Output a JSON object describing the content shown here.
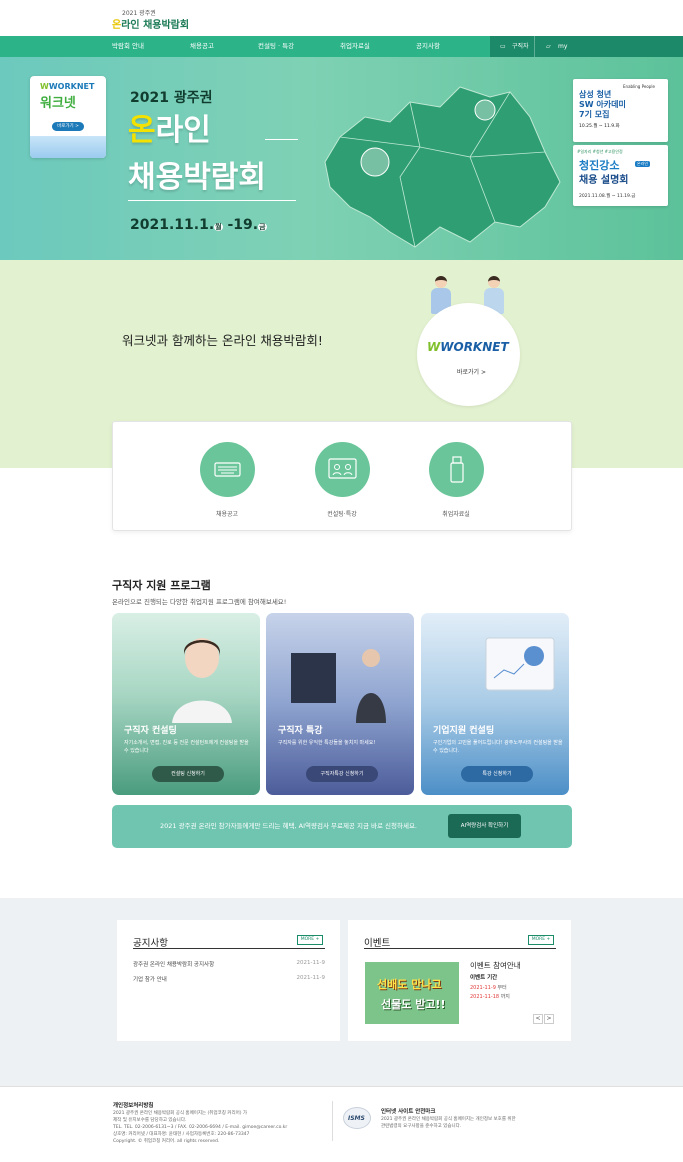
{
  "header": {
    "logo_year": "2021 광주권",
    "logo_on": "온",
    "logo_rest": "라인 채용박람회"
  },
  "nav": {
    "items": [
      "박람회 안내",
      "채용공고",
      "컨설팅 · 특강",
      "취업자료실",
      "공지사항"
    ],
    "login": "구직자",
    "my": "my"
  },
  "hero": {
    "year": "2021 광주권",
    "title_on": "온",
    "title_rest": "라인",
    "title2": "채용박람회",
    "date": "2021.11.1.",
    "date_start_day": "월",
    "date_end": "-19.",
    "date_end_day": "금",
    "worknet_logo": "WORKNET",
    "worknet_kr": "워크넷",
    "worknet_btn": "바로가기 >",
    "banner1": {
      "brand": "Enabling People",
      "line1": "삼성 청년",
      "line2": "SW 아카데미",
      "line3": "7기 모집",
      "dates": "10.25.월 ~ 11.9.화"
    },
    "banner2": {
      "tags": "#일자리 #청년 #고용안정",
      "line1": "청년친화",
      "line2": "청진강소",
      "line3": "채용 설명회",
      "badge": "온라인",
      "dates": "2021.11.08.월 ~ 11.19.금"
    }
  },
  "worknet": {
    "slogan": "워크넷과 함께하는 온라인 채용박람회!",
    "logo": "WORKNET",
    "go": "바로가기 >"
  },
  "quick": [
    {
      "label": "채용공고",
      "icon": "keyboard-icon"
    },
    {
      "label": "컨설팅·특강",
      "icon": "video-call-icon"
    },
    {
      "label": "취업자료실",
      "icon": "usb-icon"
    }
  ],
  "programs": {
    "title": "구직자 지원 프로그램",
    "subtitle": "온라인으로 진행되는 다양한 취업지원 프로그램에 참여해보세요!",
    "cards": [
      {
        "title": "구직자 컨설팅",
        "desc": "자기소개서, 면접, 진로 등 전문 컨설턴트에게 컨설팅을 받을 수 있습니다",
        "button": "컨설팅 신청하기"
      },
      {
        "title": "구직자 특강",
        "desc": "구직자를 위한 유익한 특강들을 놓치지 마세요!",
        "button": "구직자특강 신청하기"
      },
      {
        "title": "기업지원 컨설팅",
        "desc": "구인기업의 고민을 풀어드립니다! 광주노무사의 컨설팅을 받을 수 있습니다.",
        "button": "특강 신청하기"
      }
    ],
    "ai_text": "2021 광주권 온라인 참가자들에게만 드리는 혜택, AI역량검사 무료제공 지금 바로 신청하세요.",
    "ai_button": "AI역량검사 확인하기"
  },
  "notice": {
    "title": "공지사항",
    "more": "MORE +",
    "rows": [
      {
        "title": "광주권 온라인 채용박람회 공지사항",
        "date": "2021-11-9"
      },
      {
        "title": "기업 참가 안내",
        "date": "2021-11-9"
      }
    ]
  },
  "event": {
    "title": "이벤트",
    "more": "MORE +",
    "heading": "이벤트 참여안내",
    "period_label": "이벤트 기간",
    "start": "2021-11-9",
    "start_suffix": "부터",
    "end": "2021-11-18",
    "end_suffix": "까지",
    "img_line1": "선배도 만나고",
    "img_line2": "선물도 받고!!",
    "prev": "<",
    "next": ">"
  },
  "footer": {
    "privacy_title": "개인정보처리방침",
    "lines": [
      "2021 광주권 온라인 채용박람회 공식 홈페이지는 (취업코칭 커리어) 가",
      "제작 및 유지보수를 담당하고 있습니다.",
      "TEL. TEL. 02-2006-6131~3 / FAX. 02-2006-6694 / E-mail. gimoe@career.co.kr",
      "상호명: 커리어넷 / 대표자명: 윤태현 / 사업자등록번호: 220-86-73347",
      "Copyright. © 취업코칭 커리어. all rights reserved."
    ],
    "isms_badge": "ISMS",
    "isms_title": "인터넷 사이트 안전마크",
    "isms_lines": [
      "2021 광주권 온라인 채용박람회 공식 홈페이지는 개인정보 보호를 위한",
      "관련법령의 요구사항을 준수하고 있습니다."
    ]
  },
  "colors": {
    "brand_green": "#2db388",
    "dark_green": "#1c8a68",
    "light_green_bg": "#e2f1cf",
    "board_bg": "#eef1f4"
  }
}
